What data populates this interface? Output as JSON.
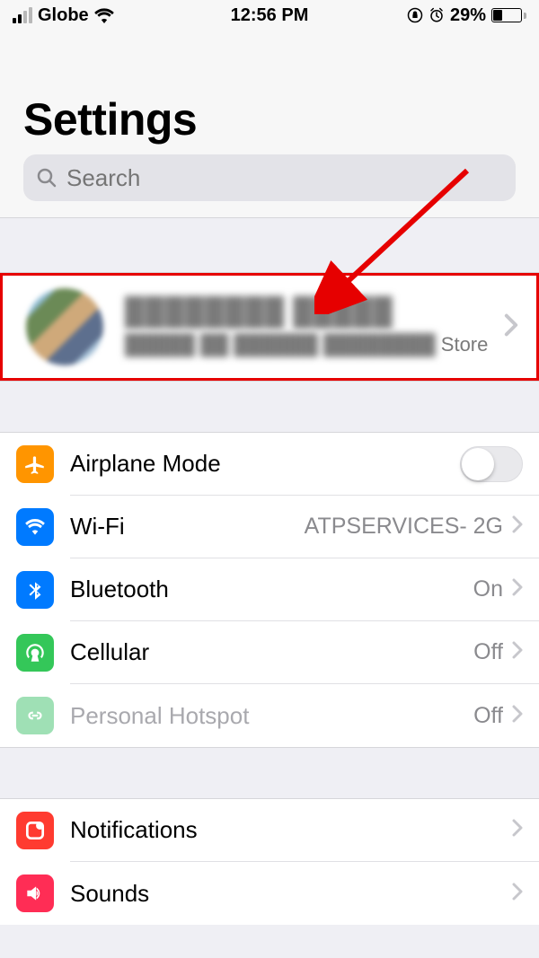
{
  "status": {
    "carrier": "Globe",
    "time": "12:56 PM",
    "battery_percent": "29%"
  },
  "page": {
    "title": "Settings"
  },
  "search": {
    "placeholder": "Search"
  },
  "account": {
    "name_obscured": "████████ █████",
    "subtitle_obscured": "█████ ██ ██████ ████████",
    "subtitle_visible": " Store"
  },
  "settings": {
    "group1": [
      {
        "key": "airplane",
        "label": "Airplane Mode",
        "detail": "",
        "control": "toggle",
        "toggle_on": false,
        "icon_bg": "#ff9500"
      },
      {
        "key": "wifi",
        "label": "Wi-Fi",
        "detail": "ATPSERVICES- 2G",
        "control": "chevron",
        "icon_bg": "#007aff"
      },
      {
        "key": "bluetooth",
        "label": "Bluetooth",
        "detail": "On",
        "control": "chevron",
        "icon_bg": "#007aff"
      },
      {
        "key": "cellular",
        "label": "Cellular",
        "detail": "Off",
        "control": "chevron",
        "icon_bg": "#34c759"
      },
      {
        "key": "hotspot",
        "label": "Personal Hotspot",
        "detail": "Off",
        "control": "chevron",
        "icon_bg": "#9fe0b5",
        "dim": true
      }
    ],
    "group2": [
      {
        "key": "notifications",
        "label": "Notifications",
        "detail": "",
        "control": "chevron",
        "icon_bg": "#ff3b30"
      },
      {
        "key": "sounds",
        "label": "Sounds",
        "detail": "",
        "control": "chevron",
        "icon_bg": "#ff2d55"
      }
    ]
  }
}
